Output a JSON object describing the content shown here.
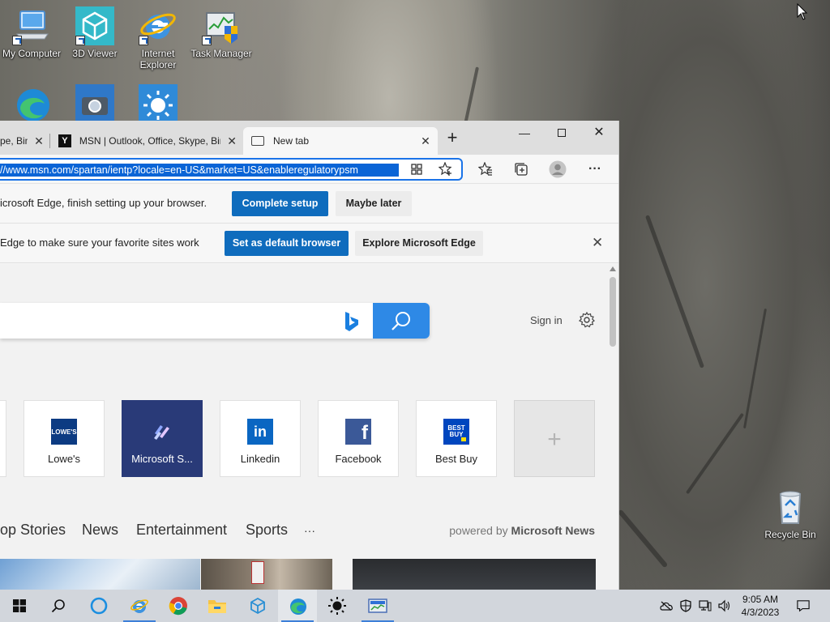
{
  "desktop": {
    "icons": [
      {
        "label": "My Computer"
      },
      {
        "label": "3D Viewer"
      },
      {
        "label": "Internet Explorer"
      },
      {
        "label": "Task Manager"
      },
      {
        "label": "Recycle Bin"
      }
    ]
  },
  "browser": {
    "tabs": [
      {
        "title": "pe, Bin"
      },
      {
        "title": "MSN | Outlook, Office, Skype, Bin"
      },
      {
        "title": "New tab"
      }
    ],
    "address_url": "//www.msn.com/spartan/ientp?locale=en-US&market=US&enableregulatorypsm",
    "setup_bar": {
      "message": "icrosoft Edge, finish setting up your browser.",
      "primary": "Complete setup",
      "secondary": "Maybe later"
    },
    "default_bar": {
      "message": "Edge to make sure your favorite sites work",
      "primary": "Set as default browser",
      "secondary": "Explore Microsoft Edge"
    },
    "page": {
      "sign_in": "Sign in",
      "tiles": [
        {
          "name": "Lowe's"
        },
        {
          "name": "Microsoft S..."
        },
        {
          "name": "Linkedin"
        },
        {
          "name": "Facebook"
        },
        {
          "name": "Best Buy"
        }
      ],
      "feed_nav": [
        "op Stories",
        "News",
        "Entertainment",
        "Sports",
        "···"
      ],
      "powered_prefix": "powered by",
      "powered_brand": "Microsoft News"
    }
  },
  "taskbar": {
    "time": "9:05 AM",
    "date": "4/3/2023"
  },
  "colors": {
    "accent": "#0f6cbd",
    "search_button": "#2e89e6",
    "taskbar": "#d2d6dc"
  }
}
